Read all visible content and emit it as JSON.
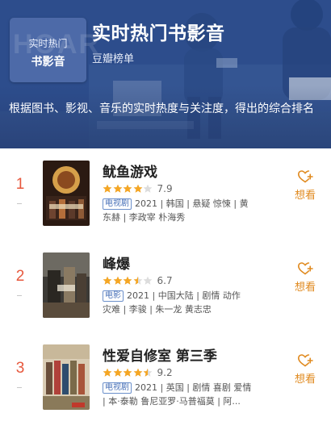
{
  "header": {
    "tile_line1": "实时热门",
    "tile_line2": "书影音",
    "tile_bg_letters": "HOAR",
    "title": "实时热门书影音",
    "subtitle": "豆瓣榜单",
    "description": "根据图书、影视、音乐的实时热度与关注度，得出的综合排名"
  },
  "colors": {
    "banner": "#2e4f8f",
    "rank": "#e7583d",
    "star": "#f5a623",
    "tag": "#4a72b8",
    "want": "#e08a1f"
  },
  "items": [
    {
      "rank": "1",
      "title": "鱿鱼游戏",
      "stars": 4,
      "score": "7.9",
      "tag": "电视剧",
      "info": "2021 | 韩国 | 悬疑 惊悚 | 黄",
      "info2": "东赫 | 李政宰 朴海秀",
      "want_label": "想看",
      "want_icon": "heart-plus-icon",
      "poster_icon": "poster-image"
    },
    {
      "rank": "2",
      "title": "峰爆",
      "stars": 3.5,
      "score": "6.7",
      "tag": "电影",
      "info": "2021 | 中国大陆 | 剧情 动作",
      "info2": "灾难 | 李骏 | 朱一龙 黄志忠",
      "want_label": "想看",
      "want_icon": "heart-plus-icon",
      "poster_icon": "poster-image"
    },
    {
      "rank": "3",
      "title": "性爱自修室 第三季",
      "stars": 4.5,
      "score": "9.2",
      "tag": "电视剧",
      "info": "2021 | 英国 | 剧情 喜剧 爱情",
      "info2": "| 本·泰勒 鲁尼亚罗·马普福莫 | 阿...",
      "want_label": "想看",
      "want_icon": "heart-plus-icon",
      "poster_icon": "poster-image"
    }
  ]
}
